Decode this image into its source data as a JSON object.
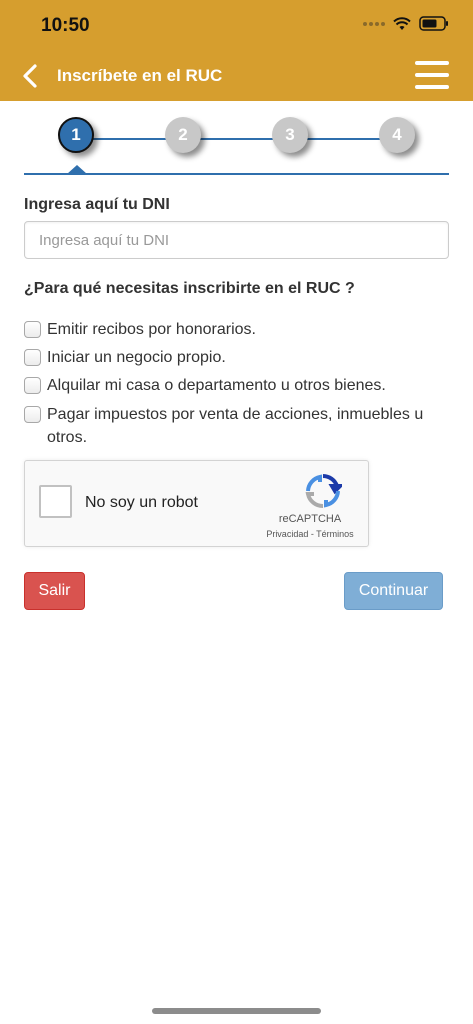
{
  "status_bar": {
    "time": "10:50"
  },
  "header": {
    "title": "Inscríbete en el RUC"
  },
  "stepper": {
    "steps": [
      "1",
      "2",
      "3",
      "4"
    ],
    "active_step": 1
  },
  "form": {
    "dni_label": "Ingresa aquí tu DNI",
    "dni_placeholder": "Ingresa aquí tu DNI",
    "dni_value": "",
    "question": "¿Para qué necesitas inscribirte en el RUC ?",
    "options": [
      {
        "label": "Emitir recibos por honorarios.",
        "checked": false
      },
      {
        "label": "Iniciar un negocio propio.",
        "checked": false
      },
      {
        "label": "Alquilar mi casa o departamento u otros bienes.",
        "checked": false
      },
      {
        "label": "Pagar impuestos por venta de acciones, inmuebles u otros.",
        "checked": false
      }
    ]
  },
  "recaptcha": {
    "label": "No soy un robot",
    "brand": "reCAPTCHA",
    "links": "Privacidad - Términos",
    "checked": false
  },
  "actions": {
    "exit_label": "Salir",
    "continue_label": "Continuar"
  },
  "colors": {
    "header": "#d69e2e",
    "primary": "#2f6fad",
    "danger": "#d9534f",
    "continue": "#7faed6"
  }
}
